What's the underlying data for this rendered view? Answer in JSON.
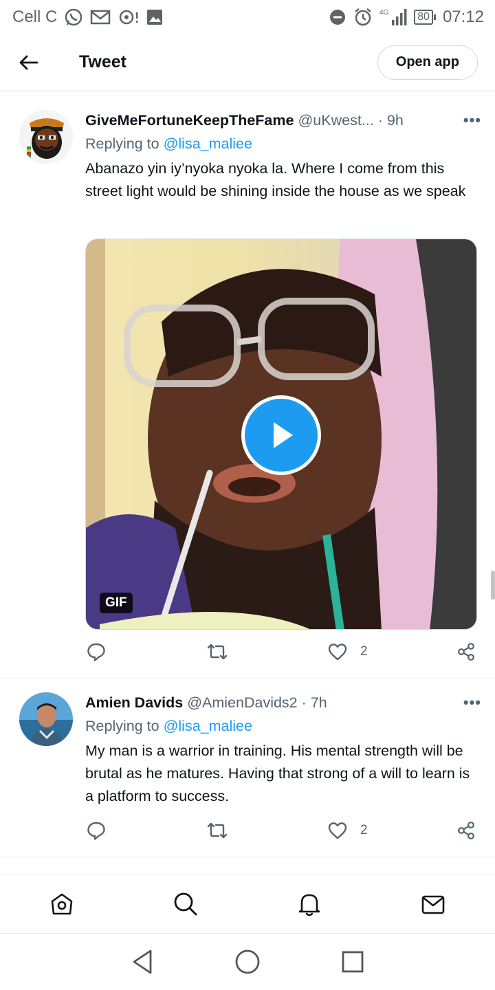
{
  "status_bar": {
    "carrier": "Cell C",
    "network": "4G",
    "battery": "80",
    "time": "07:12",
    "icons": [
      "whatsapp-icon",
      "mail-icon",
      "hotspot-icon",
      "image-icon",
      "dnd-icon",
      "alarm-icon",
      "signal-icon",
      "battery-icon"
    ]
  },
  "header": {
    "title": "Tweet",
    "open_app_label": "Open app"
  },
  "tweets": [
    {
      "name": "GiveMeFortuneKeepTheFame",
      "handle": "@uKwest...",
      "separator": "·",
      "time": "9h",
      "replying_prefix": "Replying to",
      "replying_to": "@lisa_maliee",
      "text": "Abanazo yin iy’nyoka nyoka la. Where I come from this street light would be shining inside the house as we speak",
      "media_badge": "GIF",
      "like_count": "2"
    },
    {
      "name": "Amien Davids",
      "handle": "@AmienDavids2",
      "separator": "·",
      "time": "7h",
      "replying_prefix": "Replying to",
      "replying_to": "@lisa_maliee",
      "text": "My man is a warrior in training. His mental strength will be brutal as he matures. Having that strong of a will to learn is a platform to success.",
      "like_count": "2"
    }
  ],
  "bottom_nav": [
    "home-icon",
    "search-icon",
    "notifications-icon",
    "messages-icon"
  ],
  "system_nav": [
    "back-icon",
    "home-icon",
    "recents-icon"
  ],
  "colors": {
    "accent": "#1d9bf0",
    "text": "#0f1419",
    "secondary": "#536471"
  }
}
